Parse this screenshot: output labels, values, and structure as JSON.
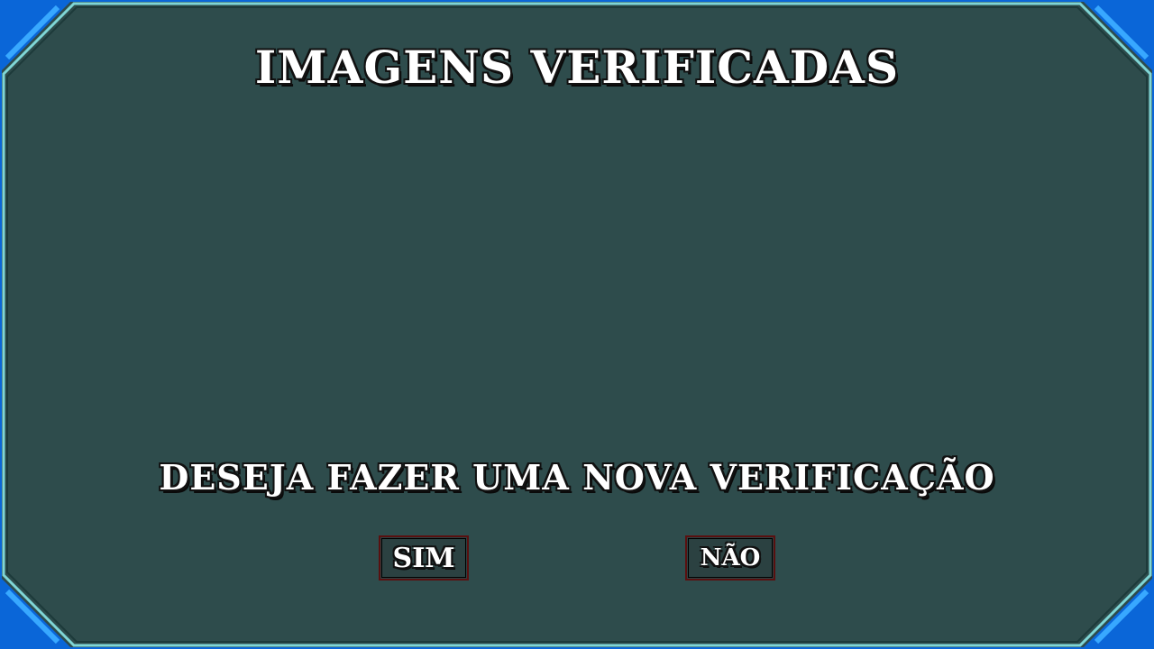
{
  "dialog": {
    "title": "IMAGENS VERIFICADAS",
    "prompt": "DESEJA FAZER UMA NOVA VERIFICAÇÃO",
    "yes_label": "SIM",
    "no_label": "NÃO"
  },
  "colors": {
    "background": "#2e4c4c",
    "frame_outer": "#0a66d8",
    "frame_inner": "#7fd6d6",
    "button_border": "#5a1010",
    "text": "#ffffff"
  }
}
